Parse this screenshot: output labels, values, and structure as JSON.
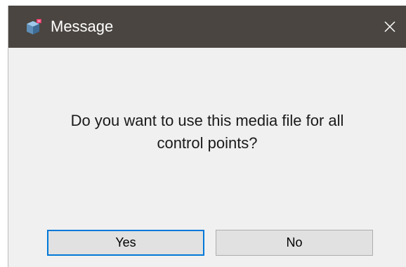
{
  "window": {
    "title": "Message",
    "app_icon": "app-3d-icon",
    "close_icon": "close-icon"
  },
  "message": {
    "line1": "Do you want to use this media file for all",
    "line2": "control points?"
  },
  "buttons": {
    "yes_label": "Yes",
    "no_label": "No",
    "default": "yes"
  },
  "colors": {
    "titlebar": "#4a4540",
    "body": "#f0f0f0",
    "default_button_border": "#0078d7"
  }
}
